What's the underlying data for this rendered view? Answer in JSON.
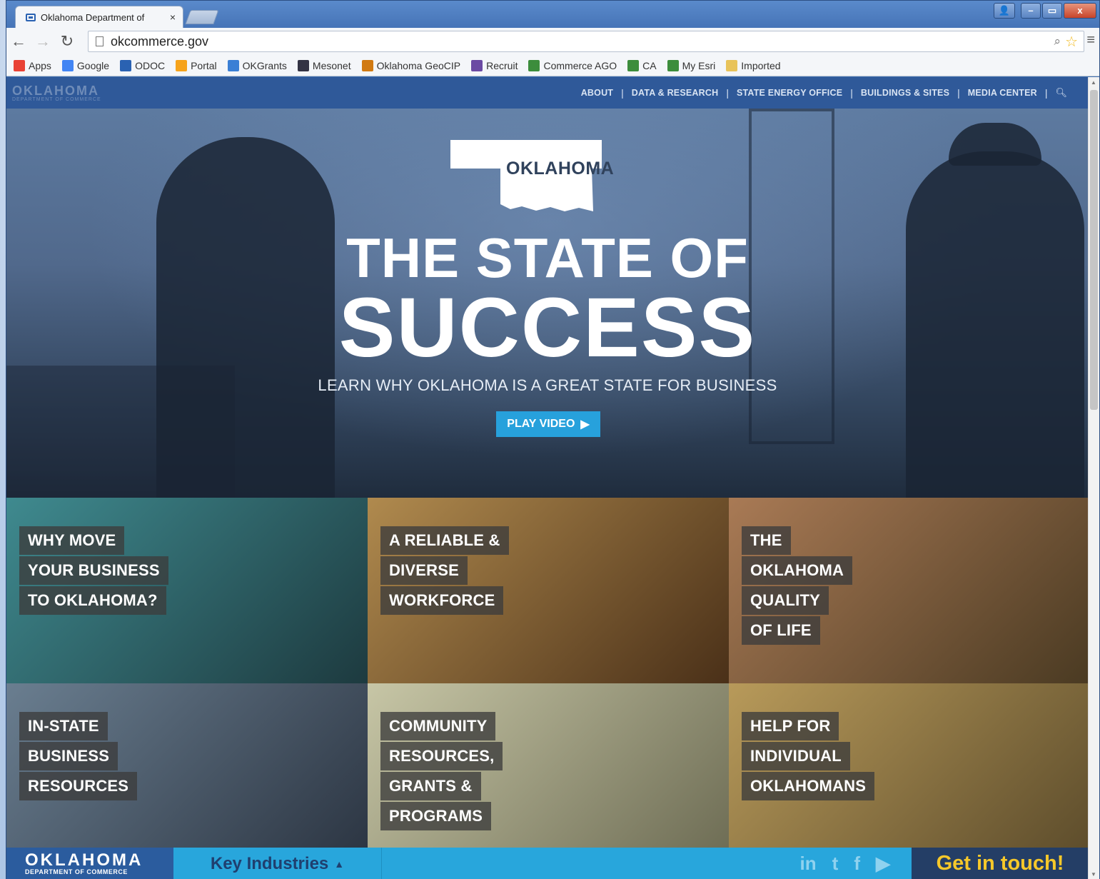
{
  "browser": {
    "tab_title": "Oklahoma Department of",
    "tab_close": "×",
    "url": "okcommerce.gov",
    "window_controls": {
      "minimize": "–",
      "maximize": "▭",
      "close": "x"
    }
  },
  "bookmarks": [
    {
      "label": "Apps",
      "icon": "apps-grid-icon",
      "color": "#e94235"
    },
    {
      "label": "Google",
      "icon": "google-icon",
      "color": "#4285f4"
    },
    {
      "label": "ODOC",
      "icon": "odoc-icon",
      "color": "#2a62b2"
    },
    {
      "label": "Portal",
      "icon": "portal-icon",
      "color": "#f6a31b"
    },
    {
      "label": "OKGrants",
      "icon": "ie-icon",
      "color": "#3a7fd5"
    },
    {
      "label": "Mesonet",
      "icon": "mesonet-icon",
      "color": "#334"
    },
    {
      "label": "Oklahoma GeoCIP",
      "icon": "geocip-icon",
      "color": "#d17a12"
    },
    {
      "label": "Recruit",
      "icon": "pin-icon",
      "color": "#6b4aa3"
    },
    {
      "label": "Commerce AGO",
      "icon": "globe-icon",
      "color": "#3c8d3c"
    },
    {
      "label": "CA",
      "icon": "esri-icon",
      "color": "#3c8d3c"
    },
    {
      "label": "My Esri",
      "icon": "esri-icon",
      "color": "#3c8d3c"
    },
    {
      "label": "Imported",
      "icon": "folder-icon",
      "color": "#e8c35a"
    }
  ],
  "site": {
    "logo_line1": "OKLAHOMA",
    "logo_line2": "DEPARTMENT OF COMMERCE",
    "nav": [
      "ABOUT",
      "DATA & RESEARCH",
      "STATE ENERGY OFFICE",
      "BUILDINGS & SITES",
      "MEDIA CENTER"
    ],
    "nav_separator": "|"
  },
  "hero": {
    "badge_text": "OKLAHOMA",
    "headline_1": "THE STATE OF",
    "headline_2": "SUCCESS",
    "subhead": "LEARN WHY OKLAHOMA IS A GREAT STATE FOR BUSINESS",
    "cta_label": "PLAY VIDEO",
    "cta_icon": "▶"
  },
  "tiles": [
    {
      "lines": [
        "WHY MOVE",
        "YOUR BUSINESS",
        "TO OKLAHOMA?"
      ],
      "bg": [
        "#3f8a8f",
        "#1d3a3f"
      ]
    },
    {
      "lines": [
        "A RELIABLE &",
        "DIVERSE",
        "WORKFORCE"
      ],
      "bg": [
        "#b08a4e",
        "#4a3018"
      ]
    },
    {
      "lines": [
        "THE",
        "OKLAHOMA",
        "QUALITY",
        "OF LIFE"
      ],
      "bg": [
        "#a97a55",
        "#4a3a22"
      ]
    },
    {
      "lines": [
        "IN-STATE",
        "BUSINESS",
        "RESOURCES"
      ],
      "bg": [
        "#6a7e90",
        "#2a3340"
      ]
    },
    {
      "lines": [
        "COMMUNITY",
        "RESOURCES,",
        "GRANTS &",
        "PROGRAMS"
      ],
      "bg": [
        "#c7c6a6",
        "#6b6a52"
      ]
    },
    {
      "lines": [
        "HELP FOR",
        "INDIVIDUAL",
        "OKLAHOMANS"
      ],
      "bg": [
        "#b89a5a",
        "#5a4a2a"
      ]
    }
  ],
  "footer": {
    "logo_line1": "OKLAHOMA",
    "logo_line2": "DEPARTMENT OF COMMERCE",
    "key_industries": "Key Industries",
    "key_industries_icon": "▲",
    "socials": [
      "in",
      "t",
      "f",
      "▶"
    ],
    "get_in_touch": "Get in touch!"
  },
  "colors": {
    "nav_bg": "#2f5999",
    "cta_bg": "#27a1dc",
    "footer_bg": "#28a6dc",
    "footer_logo_bg": "#2b5c9e",
    "get_in_touch_bg": "#243e66",
    "get_in_touch_text": "#f6c82a"
  }
}
